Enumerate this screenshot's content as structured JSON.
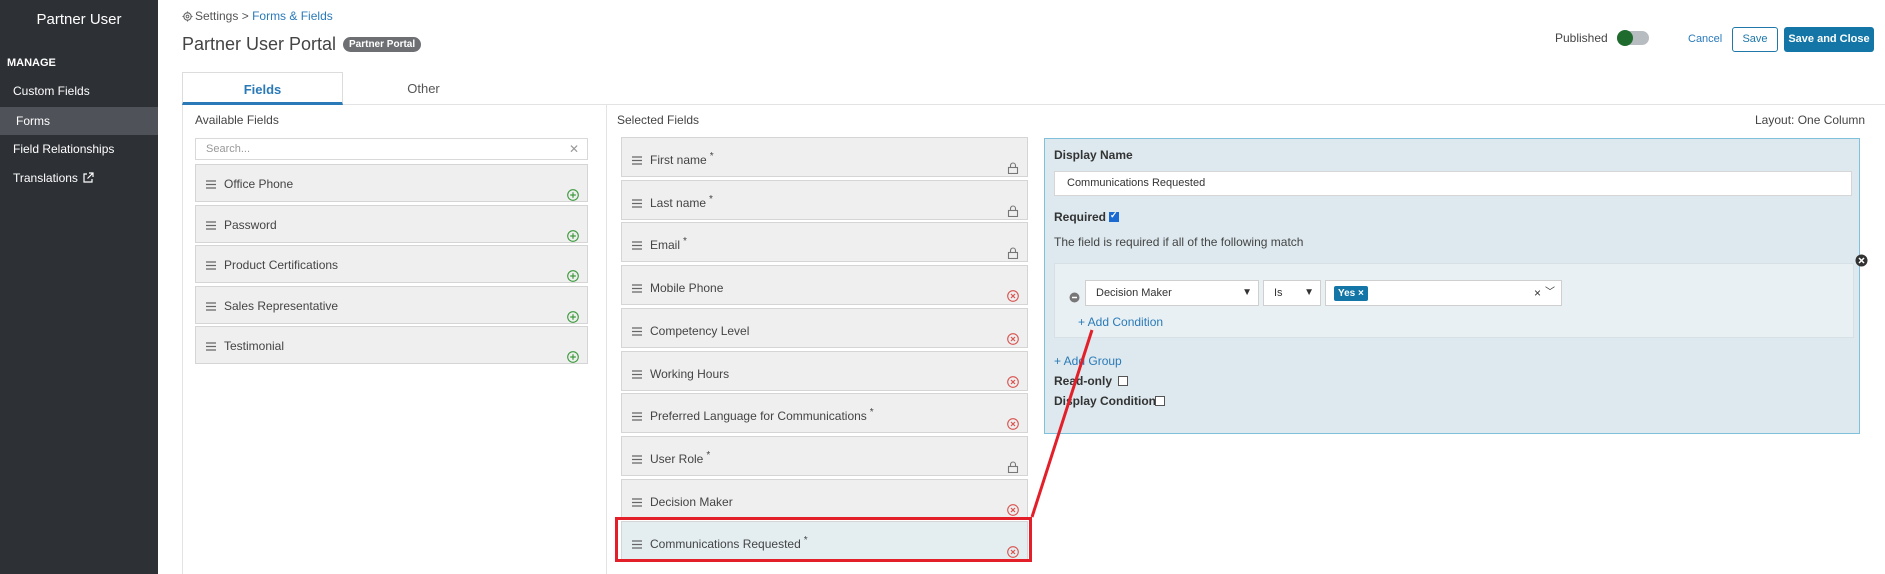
{
  "sidebar": {
    "title": "Partner User",
    "section": "MANAGE",
    "items": [
      {
        "label": "Custom Fields"
      },
      {
        "label": "Forms"
      },
      {
        "label": "Field Relationships"
      },
      {
        "label": "Translations"
      }
    ]
  },
  "header": {
    "breadcrumb_root": "Settings",
    "breadcrumb_sep": ">",
    "breadcrumb_current": "Forms & Fields",
    "title": "Partner User Portal",
    "badge": "Partner Portal",
    "published_label": "Published",
    "cancel": "Cancel",
    "save": "Save",
    "save_close": "Save and Close"
  },
  "tabs": [
    {
      "label": "Fields"
    },
    {
      "label": "Other"
    }
  ],
  "available": {
    "title": "Available Fields",
    "search_placeholder": "Search...",
    "items": [
      {
        "label": "Office Phone"
      },
      {
        "label": "Password"
      },
      {
        "label": "Product Certifications"
      },
      {
        "label": "Sales Representative"
      },
      {
        "label": "Testimonial"
      }
    ]
  },
  "selected": {
    "title": "Selected Fields",
    "layout": "Layout: One Column",
    "items": [
      {
        "label": "First name",
        "required": "*",
        "icon": "lock-icon"
      },
      {
        "label": "Last name",
        "required": "*",
        "icon": "lock-icon"
      },
      {
        "label": "Email",
        "required": "*",
        "icon": "lock-icon"
      },
      {
        "label": "Mobile Phone",
        "required": "",
        "icon": "remove-icon"
      },
      {
        "label": "Competency Level",
        "required": "",
        "icon": "remove-icon"
      },
      {
        "label": "Working Hours",
        "required": "",
        "icon": "remove-icon"
      },
      {
        "label": "Preferred Language for Communications",
        "required": "*",
        "icon": "remove-icon"
      },
      {
        "label": "User Role",
        "required": "*",
        "icon": "lock-icon"
      },
      {
        "label": "Decision Maker",
        "required": "",
        "icon": "remove-icon"
      },
      {
        "label": "Communications Requested",
        "required": "*",
        "icon": "remove-icon"
      }
    ]
  },
  "detail": {
    "display_name_label": "Display Name",
    "display_name_value": "Communications Requested",
    "required_label": "Required",
    "required_checked": true,
    "hint": "The field is required if all of the following match",
    "condition": {
      "field": "Decision Maker",
      "operator": "Is",
      "value_tag": "Yes",
      "tag_remove": "×",
      "clear": "×"
    },
    "add_condition": "+ Add Condition",
    "add_group": "+ Add Group",
    "readonly_label": "Read-only",
    "display_condition_label": "Display Condition"
  },
  "colors": {
    "sidebar_bg": "#2d3035",
    "accent": "#1476a6",
    "highlight": "#e3202a"
  }
}
